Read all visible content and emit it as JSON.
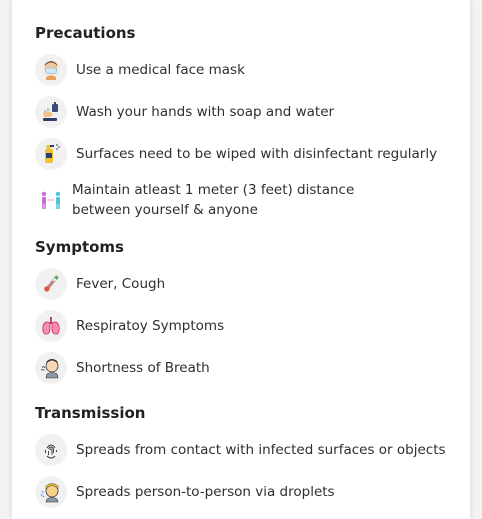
{
  "sections": {
    "precautions": {
      "title": "Precautions",
      "items": [
        {
          "icon": "face-mask-icon",
          "label": "Use a medical face mask"
        },
        {
          "icon": "hand-wash-icon",
          "label": "Wash your hands with soap and water"
        },
        {
          "icon": "disinfectant-spray-icon",
          "label": "Surfaces need to be wiped with disinfectant regularly"
        },
        {
          "icon": "social-distance-icon",
          "label": "Maintain atleast 1 meter (3 feet) distance between yourself & anyone"
        }
      ]
    },
    "symptoms": {
      "title": "Symptoms",
      "items": [
        {
          "icon": "thermometer-icon",
          "label": "Fever, Cough"
        },
        {
          "icon": "lungs-icon",
          "label": "Respiratoy Symptoms"
        },
        {
          "icon": "coughing-person-icon",
          "label": "Shortness of Breath"
        }
      ]
    },
    "transmission": {
      "title": "Transmission",
      "items": [
        {
          "icon": "fingerprint-touch-icon",
          "label": "Spreads from contact with infected surfaces or objects"
        },
        {
          "icon": "sneezing-person-icon",
          "label": "Spreads person-to-person via droplets"
        }
      ]
    }
  },
  "colors": {
    "card_background": "#ffffff",
    "page_background": "#f3f3f3",
    "icon_circle": "#f1f1f1",
    "heading_text": "#222222",
    "body_text": "#2f2f2f"
  }
}
